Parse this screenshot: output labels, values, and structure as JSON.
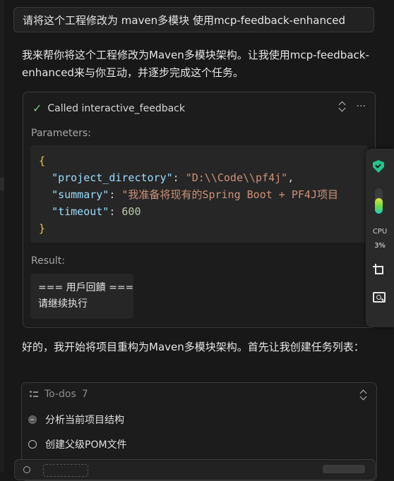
{
  "prompt": {
    "text": "请将这个工程修改为 maven多模块 使用mcp-feedback-enhanced"
  },
  "assistant": {
    "intro": "我来帮你将这个工程修改为Maven多模块架构。让我使用mcp-feedback-enhanced来与你互动，并逐步完成这个任务。",
    "followup": "好的，我开始将项目重构为Maven多模块架构。首先让我创建任务列表："
  },
  "tool_call": {
    "title": "Called interactive_feedback",
    "more": "···",
    "params_label": "Parameters:",
    "code": {
      "open": "{",
      "close": "}",
      "k1": "\"project_directory\"",
      "v1": "\"D:\\\\Code\\\\pf4j\"",
      "k2": "\"summary\"",
      "v2": "\"我准备将现有的Spring Boot + PF4J项目",
      "k3": "\"timeout\"",
      "v3": "600"
    },
    "result_label": "Result:",
    "result_text": "=== 用戶回饋 ===\n请继续执行"
  },
  "todos": {
    "label": "To-dos",
    "count": "7",
    "items": [
      {
        "text": "分析当前项目结构",
        "state": "in_progress"
      },
      {
        "text": "创建父级POM文件",
        "state": "pending"
      }
    ]
  },
  "side_panel": {
    "cpu_label": "CPU",
    "cpu_value": "3%",
    "meter_level": 0.62,
    "accent": "#22c58b"
  }
}
